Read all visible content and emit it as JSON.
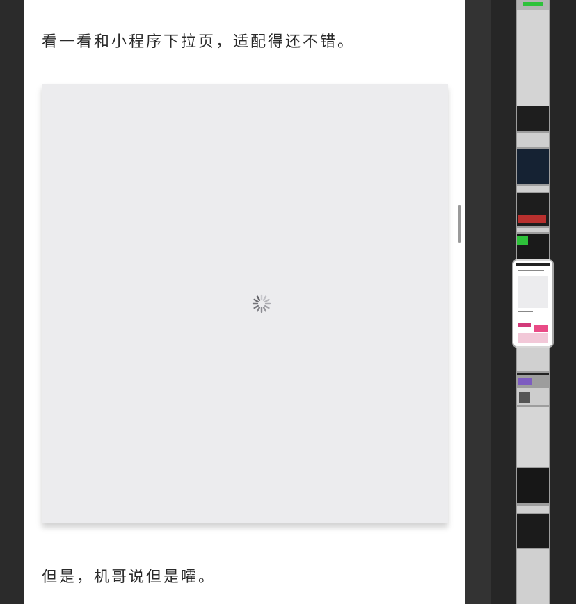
{
  "article": {
    "paragraph_1": "看一看和小程序下拉页，适配得还不错。",
    "paragraph_2": "但是，机哥说但是嚯。"
  },
  "image_placeholder": {
    "state": "loading",
    "icon": "spinner-icon"
  }
}
